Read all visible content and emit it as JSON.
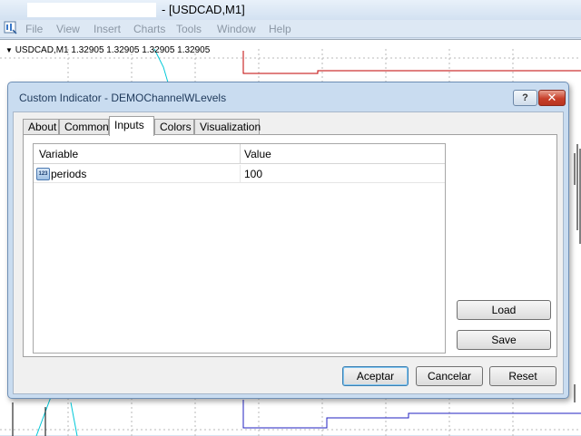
{
  "window": {
    "title": "- [USDCAD,M1]"
  },
  "menu": [
    "File",
    "View",
    "Insert",
    "Charts",
    "Tools",
    "Window",
    "Help"
  ],
  "chart": {
    "label": "USDCAD,M1  1.32905 1.32905 1.32905 1.32905"
  },
  "dialog": {
    "title": "Custom Indicator - DEMOChannelWLevels",
    "help_label": "?",
    "close_label": "✕",
    "tabs": [
      {
        "label": "About",
        "active": false
      },
      {
        "label": "Common",
        "active": false
      },
      {
        "label": "Inputs",
        "active": true
      },
      {
        "label": "Colors",
        "active": false
      },
      {
        "label": "Visualization",
        "active": false
      }
    ],
    "grid": {
      "columns": [
        "Variable",
        "Value"
      ],
      "rows": [
        {
          "icon_text": "123",
          "icon": "integer-param-icon",
          "name": "periods",
          "value": "100"
        }
      ]
    },
    "side_buttons": {
      "load": "Load",
      "save": "Save"
    },
    "footer_buttons": {
      "ok": "Aceptar",
      "cancel": "Cancelar",
      "reset": "Reset"
    }
  },
  "colors": {
    "accent": "#1e395b",
    "close_red": "#c7402a",
    "channel_red": "#c00000",
    "channel_blue": "#2020c0",
    "cyan": "#00c8d8"
  }
}
